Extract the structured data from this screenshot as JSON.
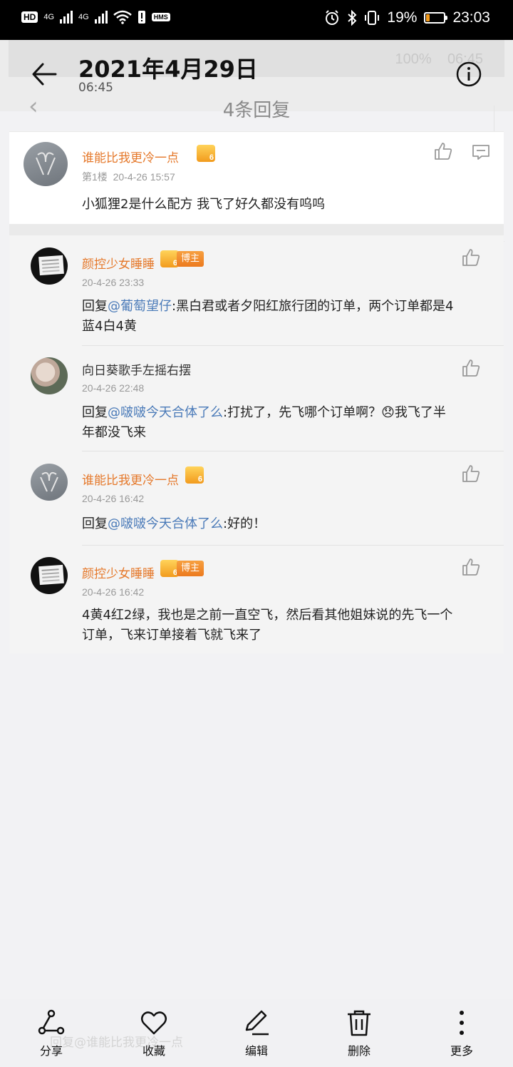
{
  "status_bar": {
    "left_badges": [
      "HD",
      "HD",
      "HMS"
    ],
    "signal_labels": [
      "4G",
      "4G"
    ],
    "battery_percent": "19%",
    "battery_level": 0.19,
    "time": "23:03"
  },
  "ghost_screenshot": {
    "status_text": "100%",
    "status_time": "06:45",
    "title": "4条回复",
    "input_placeholder": "回复@谁能比我更冷一点"
  },
  "header": {
    "date": "2021年4月29日",
    "time": "06:45"
  },
  "main_comment": {
    "username": "谁能比我更冷一点",
    "floor_label": "第1楼",
    "timestamp": "20-4-26 15:57",
    "content": "小狐狸2是什么配方 我飞了好久都没有呜呜"
  },
  "replies": [
    {
      "username": "颜控少女睡睡",
      "blogger_tag": "博主",
      "timestamp": "20-4-26 23:33",
      "reply_prefix": "回复",
      "mention": "@葡萄望仔",
      "text_line1": ":黑白君或者夕阳红旅行团的订单，两个订单都是4",
      "text_line2": "蓝4白4黄"
    },
    {
      "username": "向日葵歌手左摇右摆",
      "timestamp": "20-4-26 22:48",
      "reply_prefix": "回复",
      "mention": "@啵啵今天合体了么",
      "text_line1": ":打扰了，先飞哪个订单啊？😞我飞了半",
      "text_line2": "年都没飞来"
    },
    {
      "username": "谁能比我更冷一点",
      "timestamp": "20-4-26 16:42",
      "reply_prefix": "回复",
      "mention": "@啵啵今天合体了么",
      "text_line1": ":好的！"
    },
    {
      "username": "颜控少女睡睡",
      "blogger_tag": "博主",
      "timestamp": "20-4-26 16:42",
      "text_line1": "4黄4红2绿，我也是之前一直空飞，然后看其他姐妹说的先飞一个",
      "text_line2": "订单，飞来订单接着飞就飞来了"
    }
  ],
  "toolbar": {
    "share": "分享",
    "favorite": "收藏",
    "edit": "编辑",
    "delete": "删除",
    "more": "更多"
  },
  "colors": {
    "username_orange": "#e5782a",
    "mention_blue": "#4a7ab8",
    "battery_orange": "#f29a1b"
  }
}
